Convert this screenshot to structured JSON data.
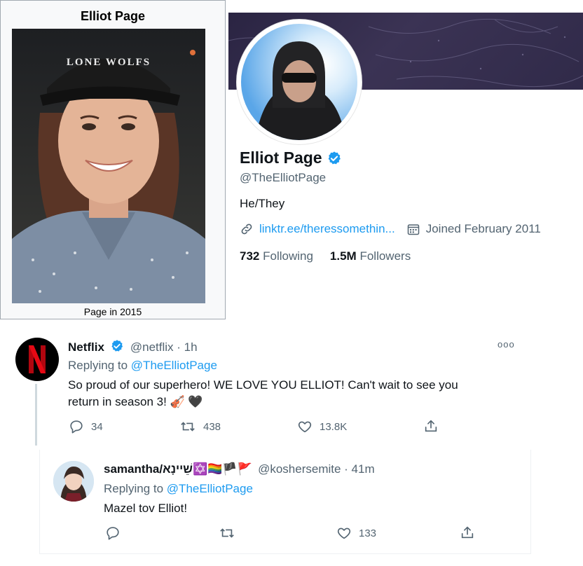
{
  "infobox": {
    "title": "Elliot Page",
    "caption": "Page in 2015",
    "hat_text": "LONE WOLFS"
  },
  "profile": {
    "name": "Elliot Page",
    "handle": "@TheElliotPage",
    "bio": "He/They",
    "link": "linktr.ee/theressomethin...",
    "joined": "Joined February 2011",
    "following_count": "732",
    "following_label": "Following",
    "followers_count": "1.5M",
    "followers_label": "Followers"
  },
  "tweet": {
    "name": "Netflix",
    "handle_time": "@netflix · 1h",
    "replying_prefix": "Replying to",
    "replying_to": "@TheElliotPage",
    "text_line1": "So proud of our superhero! WE LOVE YOU ELLIOT! Can't wait to see you",
    "text_line2": "return in season 3! 🎻 🖤",
    "replies": "34",
    "retweets": "438",
    "likes": "13.8K",
    "more": "ooo"
  },
  "reply": {
    "name": "samantha/שֵׁיינָא✡️🏳️‍🌈🏴🚩",
    "handle_time": "@koshersemite · 41m",
    "replying_prefix": "Replying to",
    "replying_to": "@TheElliotPage",
    "text": "Mazel tov Elliot!",
    "likes": "133"
  },
  "colors": {
    "accent": "#1d9bf0",
    "muted": "#536471",
    "netflix_red": "#e50914"
  }
}
